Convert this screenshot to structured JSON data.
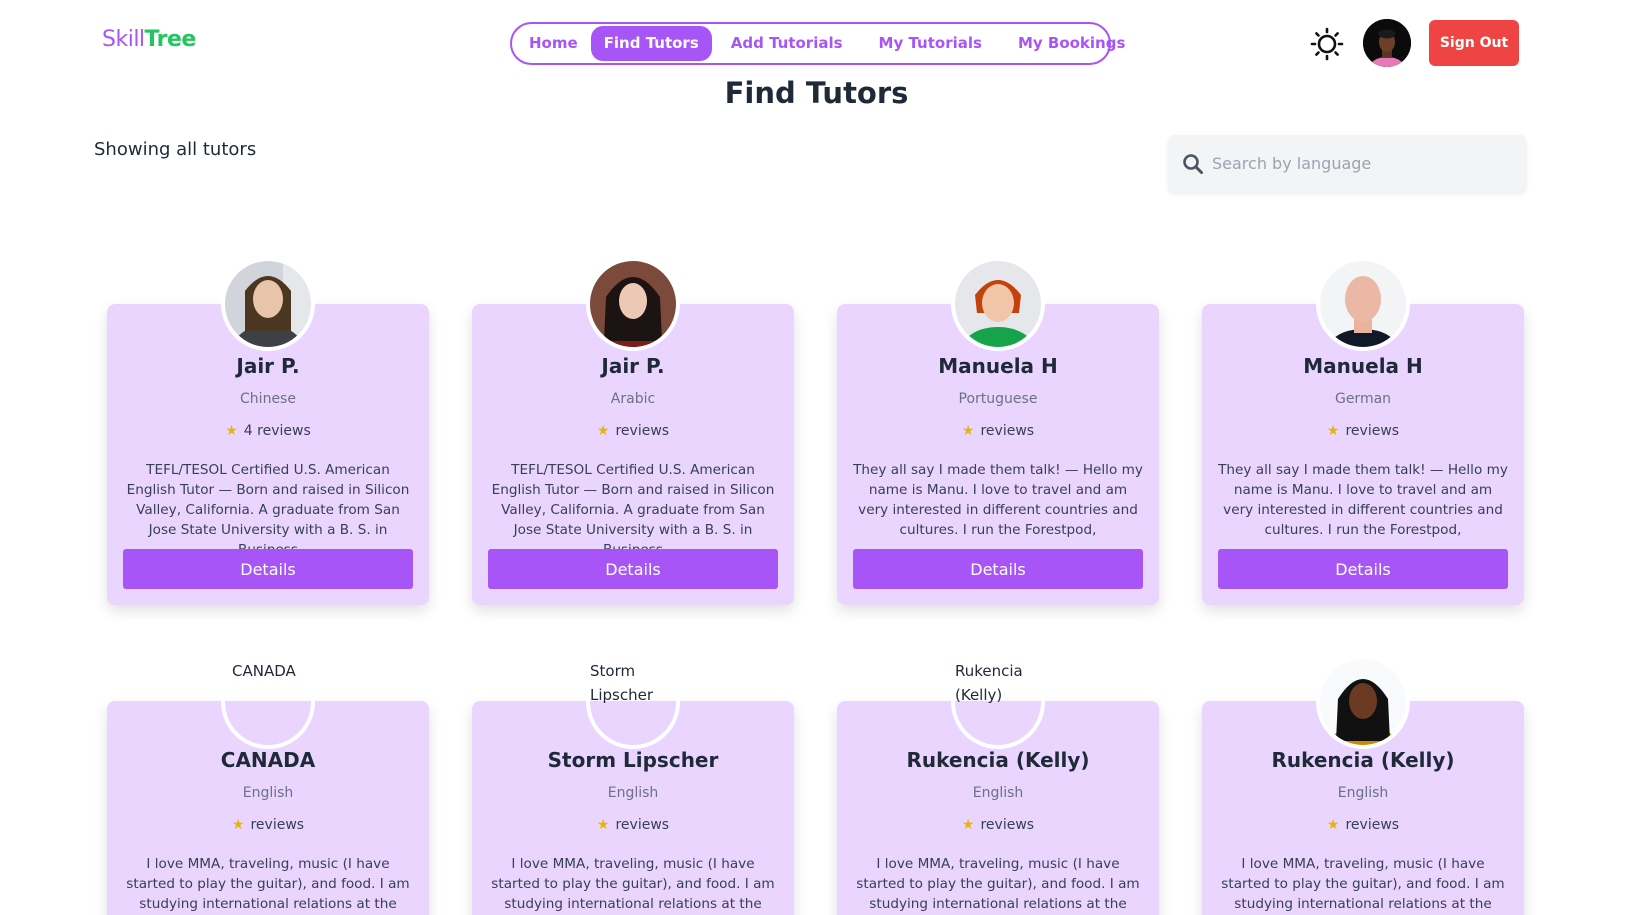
{
  "logo": {
    "part1": "Skill",
    "part2": "Tree"
  },
  "nav": {
    "items": [
      {
        "label": "Home"
      },
      {
        "label": "Find Tutors",
        "active": true
      },
      {
        "label": "Add Tutorials"
      },
      {
        "label": "My Tutorials"
      },
      {
        "label": "My Bookings"
      }
    ]
  },
  "header": {
    "theme_icon": "sun-icon",
    "signout_label": "Sign Out"
  },
  "page": {
    "title": "Find Tutors",
    "status": "Showing all tutors"
  },
  "search": {
    "placeholder": "Search by language",
    "value": ""
  },
  "tutors": [
    {
      "name": "Jair P.",
      "language": "Chinese",
      "reviews": "4 reviews",
      "description": "TEFL/TESOL Certified U.S. American English Tutor — Born and raised in Silicon Valley, California. A graduate from San Jose State University with a B. S. in Business",
      "button": "Details"
    },
    {
      "name": "Jair P.",
      "language": "Arabic",
      "reviews": "reviews",
      "description": "TEFL/TESOL Certified U.S. American English Tutor — Born and raised in Silicon Valley, California. A graduate from San Jose State University with a B. S. in Business",
      "button": "Details"
    },
    {
      "name": "Manuela H",
      "language": "Portuguese",
      "reviews": "reviews",
      "description": "They all say I made them talk! — Hello my name is Manu. I love to travel and am very interested in different countries and cultures. I run the Forestpod,",
      "button": "Details"
    },
    {
      "name": "Manuela H",
      "language": "German",
      "reviews": "reviews",
      "description": "They all say I made them talk! — Hello my name is Manu. I love to travel and am very interested in different countries and cultures. I run the Forestpod,",
      "button": "Details"
    },
    {
      "name": "CANADA",
      "language": "English",
      "reviews": "reviews",
      "alt": "CANADA",
      "description": "I love MMA, traveling, music (I have started to play the guitar), and food. I am studying international relations at the University of",
      "button": "Details"
    },
    {
      "name": "Storm Lipscher",
      "language": "English",
      "reviews": "reviews",
      "alt": "Storm Lipscher",
      "description": "I love MMA, traveling, music (I have started to play the guitar), and food. I am studying international relations at the University of",
      "button": "Details"
    },
    {
      "name": "Rukencia (Kelly)",
      "language": "English",
      "reviews": "reviews",
      "alt": "Rukencia (Kelly)",
      "description": "I love MMA, traveling, music (I have started to play the guitar), and food. I am studying international relations at the University of",
      "button": "Details"
    },
    {
      "name": "Rukencia (Kelly)",
      "language": "English",
      "reviews": "reviews",
      "description": "I love MMA, traveling, music (I have started to play the guitar), and food. I am studying international relations at the University of",
      "button": "Details"
    }
  ],
  "colors": {
    "accent": "#a855f7",
    "card_bg": "#e9d5ff",
    "danger": "#ef4444",
    "logo_green": "#22c55e",
    "star": "#eab308"
  }
}
